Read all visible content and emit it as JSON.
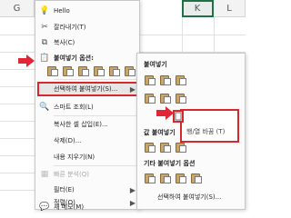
{
  "sheet": {
    "columns": [
      "G",
      "K",
      "L"
    ]
  },
  "context_menu": {
    "items": [
      {
        "label": "Hello",
        "icon": "lightbulb-icon"
      },
      {
        "label": "잘라내기(T)",
        "icon": "scissors-icon"
      },
      {
        "label": "복사(C)",
        "icon": "copy-icon"
      },
      {
        "label": "붙여넣기 옵션:",
        "icon": "paste-icon"
      },
      {
        "label": "선택하여 붙여넣기(S)...",
        "icon": ""
      },
      {
        "label": "스마트 조회(L)",
        "icon": "search-icon"
      },
      {
        "label": "복사한 셀 삽입(E)...",
        "icon": ""
      },
      {
        "label": "삭제(D)...",
        "icon": ""
      },
      {
        "label": "내용 지우기(N)",
        "icon": ""
      },
      {
        "label": "빠른 분석(Q)",
        "icon": "quick-analysis-icon"
      },
      {
        "label": "필터(E)",
        "icon": ""
      },
      {
        "label": "정렬(O)",
        "icon": ""
      },
      {
        "label": "새 메모(M)",
        "icon": "comment-icon"
      }
    ]
  },
  "submenu": {
    "section_paste": "붙여넣기",
    "section_values": "값 붙여넣기",
    "section_other": "기타 붙여넣기 옵션",
    "footer_link": "선택하여 붙여넣기(S)..."
  },
  "tooltip": {
    "text": "행/열 바꿈 (T)"
  },
  "colors": {
    "highlight": "#d9272e",
    "arrow": "#e32636",
    "grid": "#e1e1e1"
  }
}
